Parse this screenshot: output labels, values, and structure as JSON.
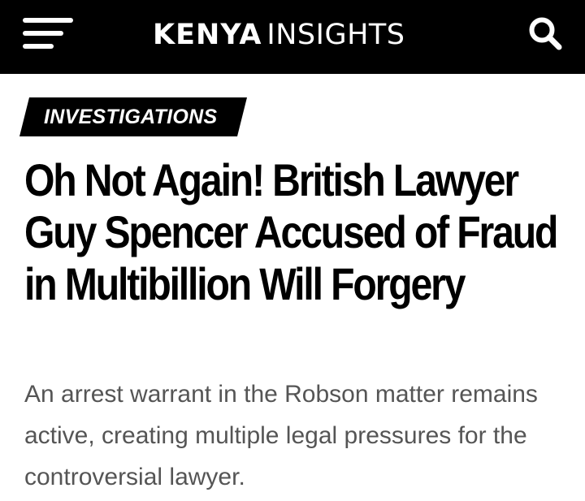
{
  "header": {
    "menu_icon": "hamburger-menu-icon",
    "logo_bold": "KENYA",
    "logo_light": "INSIGHTS",
    "search_icon": "search-icon",
    "background_color": "#000000"
  },
  "article": {
    "category": "INVESTIGATIONS",
    "title": "Oh Not Again! British Lawyer Guy Spencer Accused of Fraud in Multibillion Will Forgery",
    "subtitle": "An arrest warrant in the Robson matter remains active, creating multiple legal pressures for the controversial lawyer."
  },
  "colors": {
    "category_background": "#000000",
    "title_text": "#000000",
    "subtitle_text": "#555555"
  }
}
